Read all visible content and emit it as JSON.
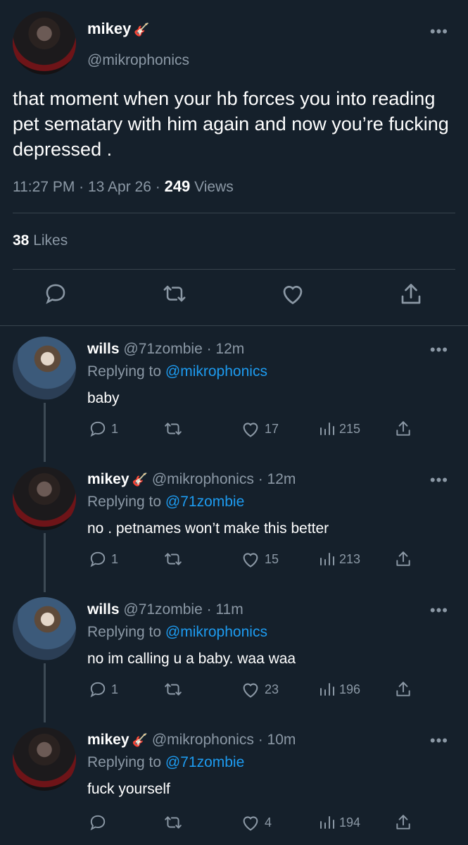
{
  "main_tweet": {
    "name": "mikey",
    "name_emoji": "🎸",
    "handle": "@mikrophonics",
    "text": "that moment when your hb forces you into reading pet sematary with him again and now you’re fucking depressed .",
    "time": "11:27 PM",
    "date": "13 Apr 26",
    "views_count": "249",
    "views_label": "Views",
    "likes_count": "38",
    "likes_label": "Likes",
    "more_icon": "more-dots-icon"
  },
  "replies": [
    {
      "name": "wills",
      "handle": "@71zombie",
      "time": "12m",
      "replying_label": "Replying to",
      "replying_to": "@mikrophonics",
      "text": "baby",
      "reply_count": "1",
      "retweet_count": "",
      "like_count": "17",
      "view_count": "215"
    },
    {
      "name": "mikey",
      "name_emoji": "🎸",
      "handle": "@mikrophonics",
      "time": "12m",
      "replying_label": "Replying to",
      "replying_to": "@71zombie",
      "text": "no . petnames won’t make this better",
      "reply_count": "1",
      "retweet_count": "",
      "like_count": "15",
      "view_count": "213"
    },
    {
      "name": "wills",
      "handle": "@71zombie",
      "time": "11m",
      "replying_label": "Replying to",
      "replying_to": "@mikrophonics",
      "text": "no im calling u a baby. waa waa",
      "reply_count": "1",
      "retweet_count": "",
      "like_count": "23",
      "view_count": "196"
    },
    {
      "name": "mikey",
      "name_emoji": "🎸",
      "handle": "@mikrophonics",
      "time": "10m",
      "replying_label": "Replying to",
      "replying_to": "@71zombie",
      "text": "fuck yourself",
      "reply_count": "",
      "retweet_count": "",
      "like_count": "4",
      "view_count": "194"
    }
  ],
  "colors": {
    "background": "#15202b",
    "secondary_text": "#8b98a5",
    "link": "#1d9bf0",
    "divider": "#38444d"
  }
}
